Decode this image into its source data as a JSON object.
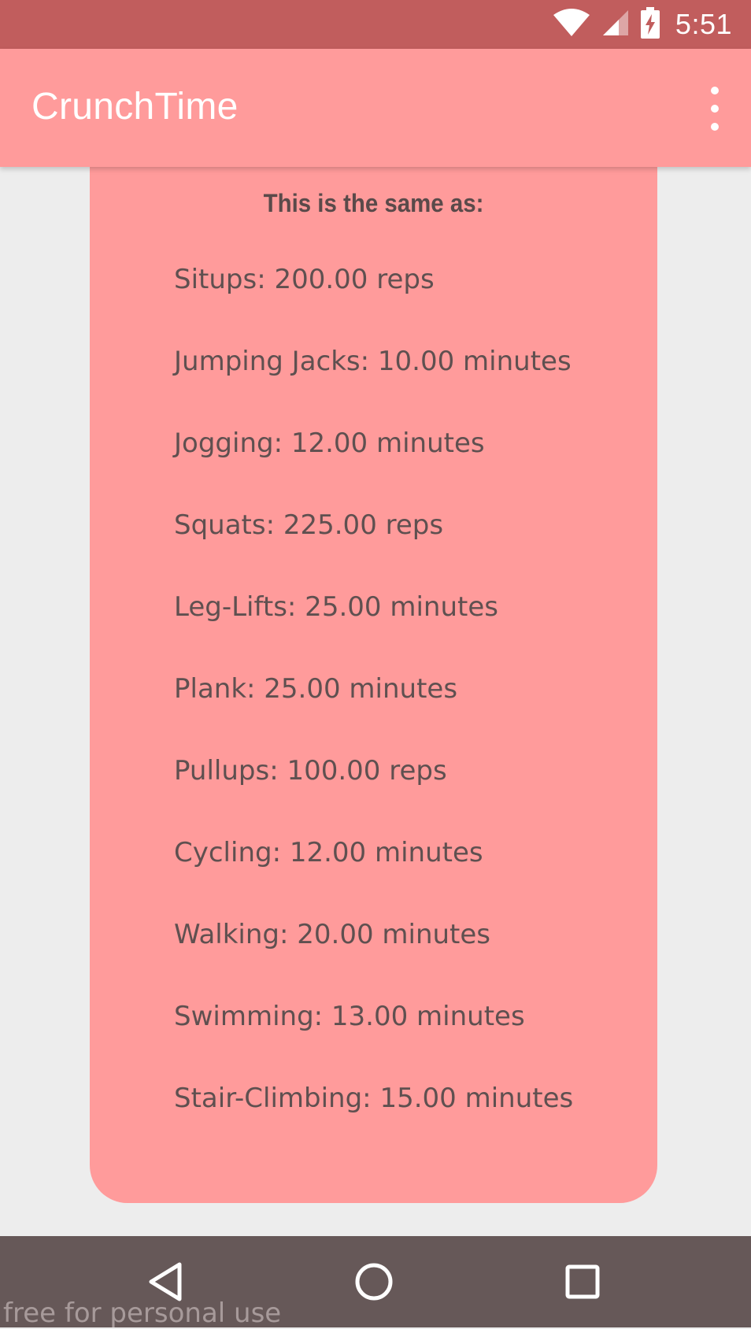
{
  "status_bar": {
    "time": "5:51",
    "icons": [
      "wifi-icon",
      "cellular-signal-icon",
      "battery-charging-icon"
    ]
  },
  "app_bar": {
    "title": "CrunchTime",
    "menu_icon": "more-vert-icon"
  },
  "card": {
    "heading": "This is the same as:",
    "items": [
      "Situps: 200.00 reps",
      "Jumping Jacks: 10.00 minutes",
      "Jogging: 12.00 minutes",
      "Squats: 225.00 reps",
      "Leg-Lifts: 25.00 minutes",
      "Plank: 25.00 minutes",
      "Pullups: 100.00 reps",
      "Cycling: 12.00 minutes",
      "Walking: 20.00 minutes",
      "Swimming: 13.00 minutes",
      "Stair-Climbing: 15.00 minutes"
    ]
  },
  "nav_bar": {
    "icons": [
      "back-icon",
      "home-icon",
      "recents-icon"
    ]
  },
  "watermark": "free for personal use",
  "colors": {
    "status_bar": "#c15d5d",
    "app_bar": "#ff9b9b",
    "card": "#ff9b9b",
    "background": "#ededed",
    "nav_bar": "#665858",
    "card_text": "#5f5050"
  }
}
